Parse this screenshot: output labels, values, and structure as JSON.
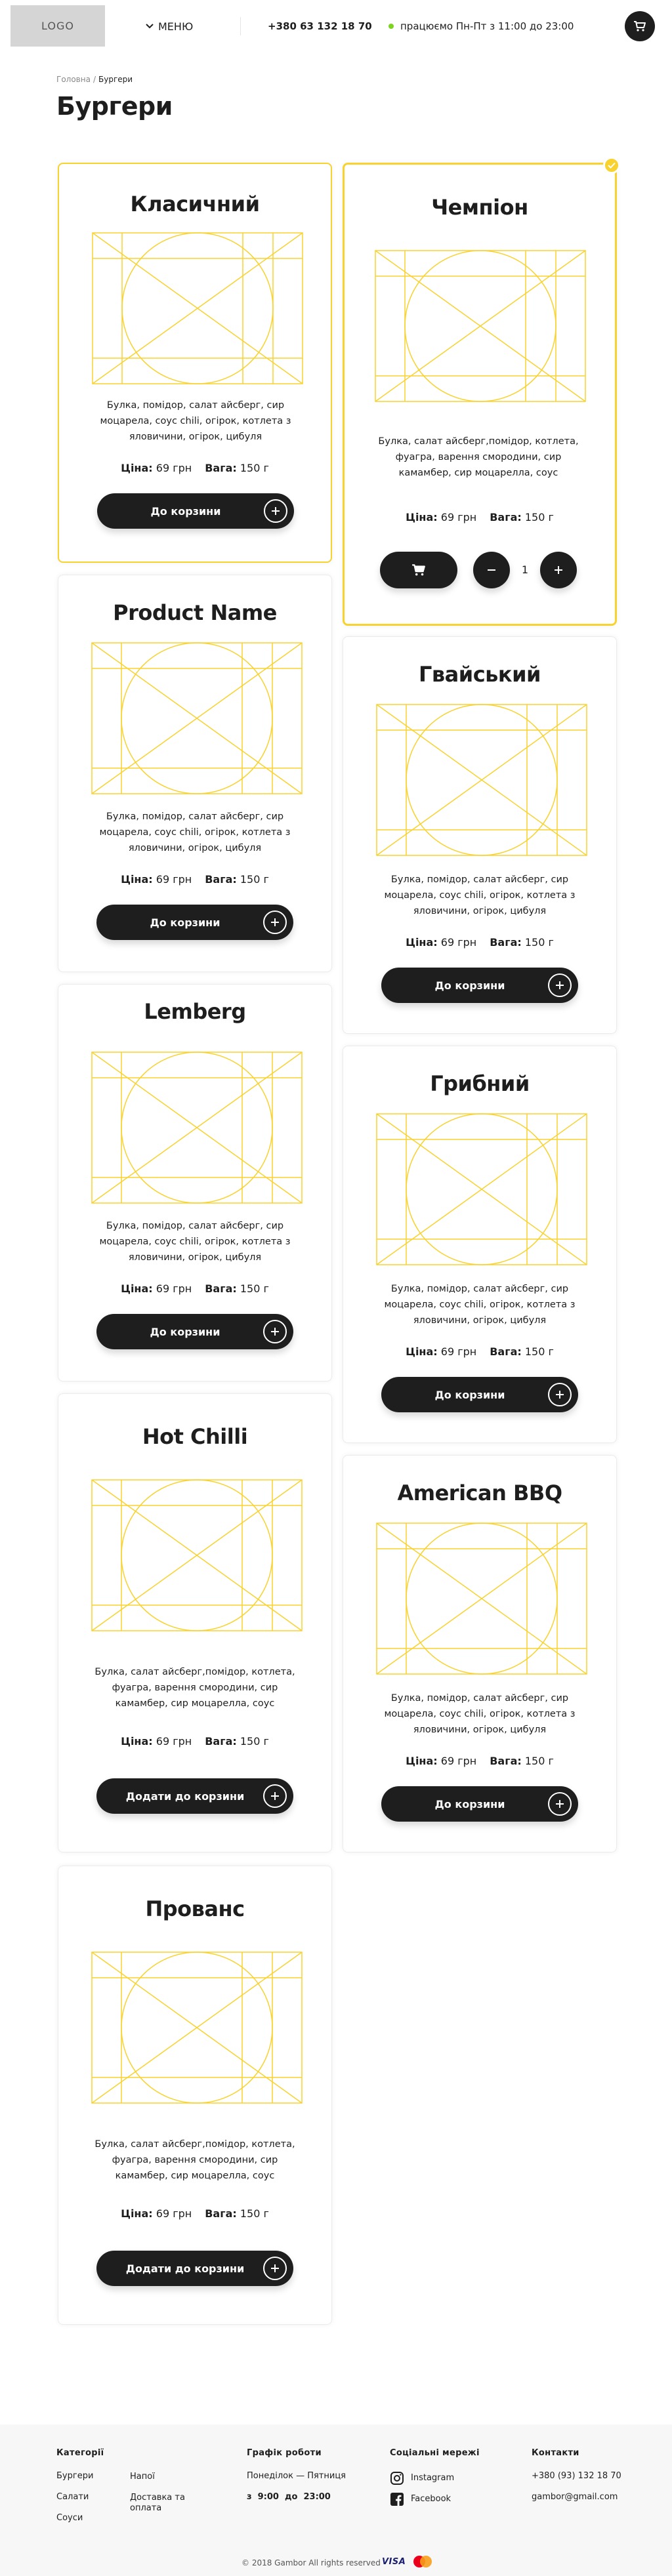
{
  "header": {
    "logo": "LOGO",
    "menu_label": "МЕНЮ",
    "phone": "+380 63 132 18 70",
    "hours": "працюємо Пн-Пт з 11:00 до 23:00"
  },
  "breadcrumb": {
    "home": "Головна",
    "sep": "/",
    "current": "Бургери"
  },
  "page_title": "Бургери",
  "labels": {
    "price": "Ціна:",
    "weight": "Вага:"
  },
  "products": [
    {
      "name": "Класичний",
      "desc": "Булка, помідор, салат айсберг, сир моцарела, соус chili, огірок, котлета з яловичини, огірок, цибуля",
      "price": "69 грн",
      "weight": "150 г",
      "button": "До корзини"
    },
    {
      "name": "Чемпіон",
      "desc": "Булка, салат айсберг,помідор, котлета, фуагра, варення смородини, сир камамбер, сир моцарелла, соус",
      "price": "69 грн",
      "weight": "150 г",
      "quantity": "1"
    },
    {
      "name": "Product Name",
      "desc": "Булка, помідор, салат айсберг, сир моцарела, соус chili, огірок, котлета з яловичини, огірок, цибуля",
      "price": "69 грн",
      "weight": "150 г",
      "button": "До корзини"
    },
    {
      "name": "Гвайський",
      "desc": "Булка, помідор, салат айсберг, сир моцарела, соус chili, огірок, котлета з яловичини, огірок, цибуля",
      "price": "69 грн",
      "weight": "150 г",
      "button": "До корзини"
    },
    {
      "name": "Lemberg",
      "desc": "Булка, помідор, салат айсберг, сир моцарела, соус chili, огірок, котлета з яловичини, огірок, цибуля",
      "price": "69 грн",
      "weight": "150 г",
      "button": "До корзини"
    },
    {
      "name": "Грибний",
      "desc": "Булка, помідор, салат айсберг, сир моцарела, соус chili, огірок, котлета з яловичини, огірок, цибуля",
      "price": "69 грн",
      "weight": "150 г",
      "button": "До корзини"
    },
    {
      "name": "Hot Chilli",
      "desc": "Булка, салат айсберг,помідор, котлета, фуагра, варення смородини, сир камамбер, сир моцарелла, соус",
      "price": "69 грн",
      "weight": "150 г",
      "button": "Додати до корзини"
    },
    {
      "name": "American BBQ",
      "desc": "Булка, помідор, салат айсберг, сир моцарела, соус chili, огірок, котлета з яловичини, огірок, цибуля",
      "price": "69 грн",
      "weight": "150 г",
      "button": "До корзини"
    },
    {
      "name": "Прованс",
      "desc": "Булка, салат айсберг,помідор, котлета, фуагра, варення смородини, сир камамбер, сир моцарелла, соус",
      "price": "69 грн",
      "weight": "150 г",
      "button": "Додати до корзини"
    }
  ],
  "footer": {
    "categories_title": "Категорії",
    "categories": [
      "Бургери",
      "Салати",
      "Соуси"
    ],
    "extra_links": [
      "Напої",
      "Доставка та оплата"
    ],
    "schedule_title": "Графік роботи",
    "schedule_days": "Понеділок — Пятниця",
    "schedule_time": "з  9:00  до  23:00",
    "social_title": "Соціальні мережі",
    "social": [
      "Instagram",
      "Facebook"
    ],
    "contacts_title": "Контакти",
    "contact_phone": "+380 (93) 132 18 70",
    "contact_email": "gambor@gmail.com",
    "copyright": "© 2018 Gambor All rights reserved",
    "visa": "VISA"
  },
  "colors": {
    "accent": "#f8d22f",
    "dark": "#1e1e1e",
    "status": "#7ed321"
  }
}
